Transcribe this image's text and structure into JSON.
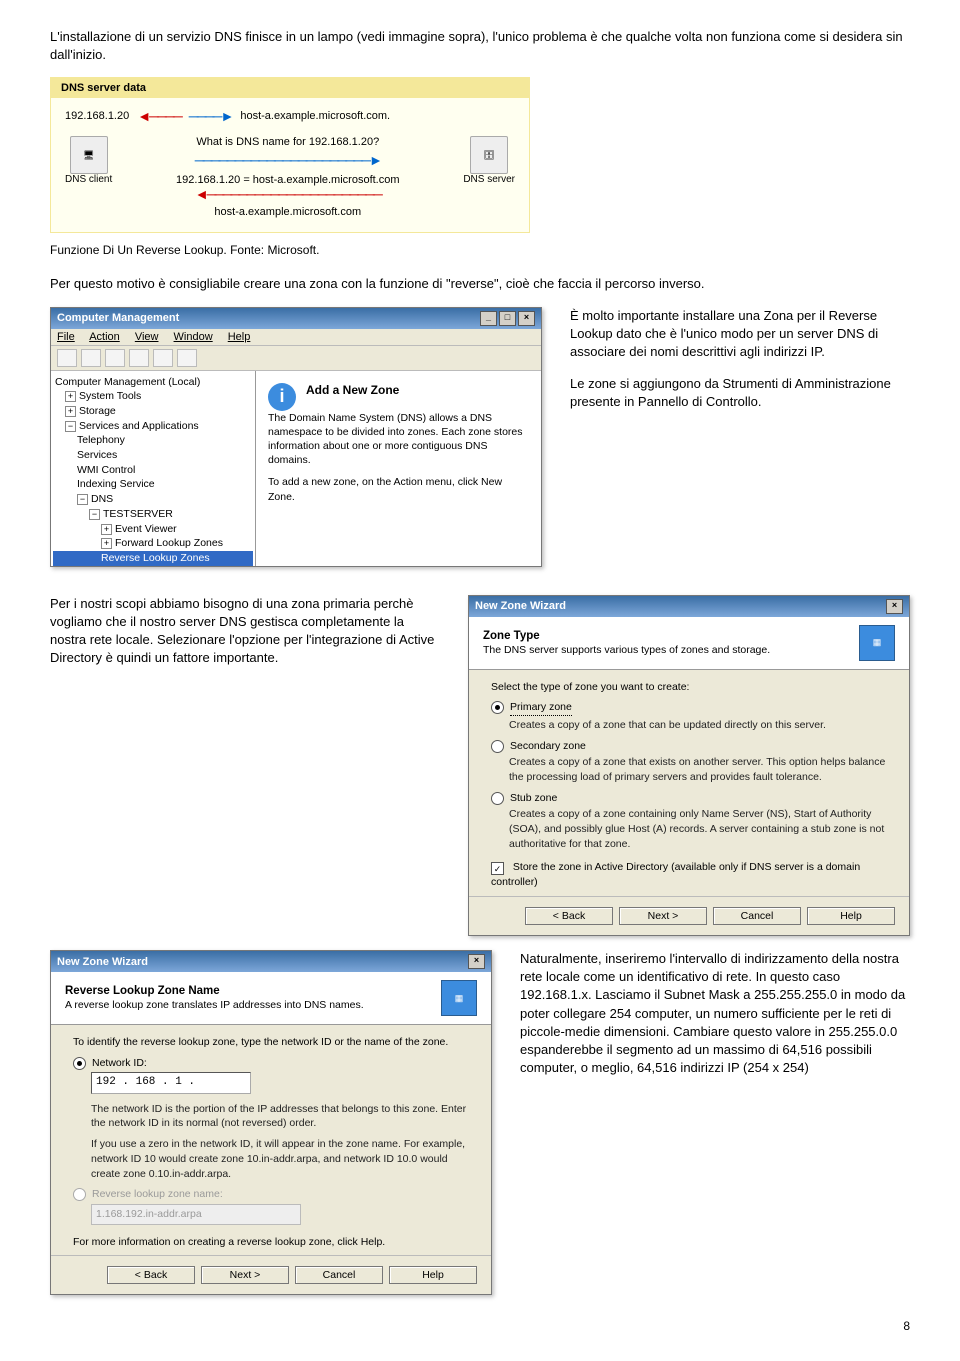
{
  "intro": "L'installazione di un servizio DNS finisce in un lampo (vedi immagine sopra), l'unico problema è che qualche volta non funziona come si desidera sin dall'inizio.",
  "diagram": {
    "title": "DNS server data",
    "ip": "192.168.1.20",
    "host": "host-a.example.microsoft.com.",
    "query": "What is DNS name for 192.168.1.20?",
    "answer": "192.168.1.20 = host-a.example.microsoft.com",
    "client_label": "DNS client",
    "server_label": "DNS server",
    "middle_label": "host-a.example.microsoft.com"
  },
  "caption": "Funzione Di Un Reverse Lookup. Fonte: Microsoft.",
  "para2": "Per questo motivo è consigliabile creare una zona con la funzione di \"reverse\", cioè che faccia il percorso inverso.",
  "compmgmt": {
    "title": "Computer Management",
    "menu": {
      "file": "File",
      "action": "Action",
      "view": "View",
      "window": "Window",
      "help": "Help"
    },
    "tree": {
      "root": "Computer Management (Local)",
      "systools": "System Tools",
      "storage": "Storage",
      "services_apps": "Services and Applications",
      "telephony": "Telephony",
      "services": "Services",
      "wmi": "WMI Control",
      "indexing": "Indexing Service",
      "dns": "DNS",
      "testserver": "TESTSERVER",
      "event_viewer": "Event Viewer",
      "fwd": "Forward Lookup Zones",
      "rev": "Reverse Lookup Zones"
    },
    "info_title": "Add a New Zone",
    "info_body1": "The Domain Name System (DNS) allows a DNS namespace to be divided into zones. Each zone stores information about one or more contiguous DNS domains.",
    "info_body2": "To add a new zone, on the Action menu, click New Zone."
  },
  "side1a": "È molto importante installare una Zona per il Reverse Lookup dato che è l'unico modo per un server DNS di associare dei nomi descrittivi agli indirizzi IP.",
  "side1b": "Le zone si aggiungono da Strumenti di Amministrazione presente in Pannello di Controllo.",
  "para3": "Per i nostri scopi abbiamo bisogno di una zona primaria perchè vogliamo che il nostro server DNS gestisca completamente la nostra rete locale. Selezionare l'opzione per l'integrazione di Active Directory è quindi un fattore importante.",
  "wizard1": {
    "title": "New Zone Wizard",
    "head_bold": "Zone Type",
    "head_sub": "The DNS server supports various types of zones and storage.",
    "prompt": "Select the type of zone you want to create:",
    "primary": "Primary zone",
    "primary_desc": "Creates a copy of a zone that can be updated directly on this server.",
    "secondary": "Secondary zone",
    "secondary_desc": "Creates a copy of a zone that exists on another server. This option helps balance the processing load of primary servers and provides fault tolerance.",
    "stub": "Stub zone",
    "stub_desc": "Creates a copy of a zone containing only Name Server (NS), Start of Authority (SOA), and possibly glue Host (A) records. A server containing a stub zone is not authoritative for that zone.",
    "store": "Store the zone in Active Directory (available only if DNS server is a domain controller)",
    "back": "< Back",
    "next": "Next >",
    "cancel": "Cancel",
    "help": "Help"
  },
  "wizard2": {
    "title": "New Zone Wizard",
    "head_bold": "Reverse Lookup Zone Name",
    "head_sub": "A reverse lookup zone translates IP addresses into DNS names.",
    "prompt": "To identify the reverse lookup zone, type the network ID or the name of the zone.",
    "netid_label": "Network ID:",
    "netid_value": "192 . 168 . 1  .",
    "net_desc1": "The network ID is the portion of the IP addresses that belongs to this zone. Enter the network ID in its normal (not reversed) order.",
    "net_desc2": "If you use a zero in the network ID, it will appear in the zone name. For example, network ID 10 would create zone 10.in-addr.arpa, and network ID 10.0 would create zone 0.10.in-addr.arpa.",
    "revname_label": "Reverse lookup zone name:",
    "revname_value": "1.168.192.in-addr.arpa",
    "more_info": "For more information on creating a reverse lookup zone, click Help.",
    "back": "< Back",
    "next": "Next >",
    "cancel": "Cancel",
    "help": "Help"
  },
  "para4": "Naturalmente, inseriremo l'intervallo di indirizzamento della nostra rete locale come un identificativo di rete. In questo caso 192.168.1.x. Lasciamo il Subnet Mask a 255.255.255.0 in modo da poter collegare 254 computer, un numero sufficiente per le reti di piccole-medie dimensioni. Cambiare questo valore in 255.255.0.0 espanderebbe il segmento ad un massimo di 64,516 possibili computer, o meglio, 64,516 indirizzi IP (254 x 254)",
  "page_num": "8"
}
